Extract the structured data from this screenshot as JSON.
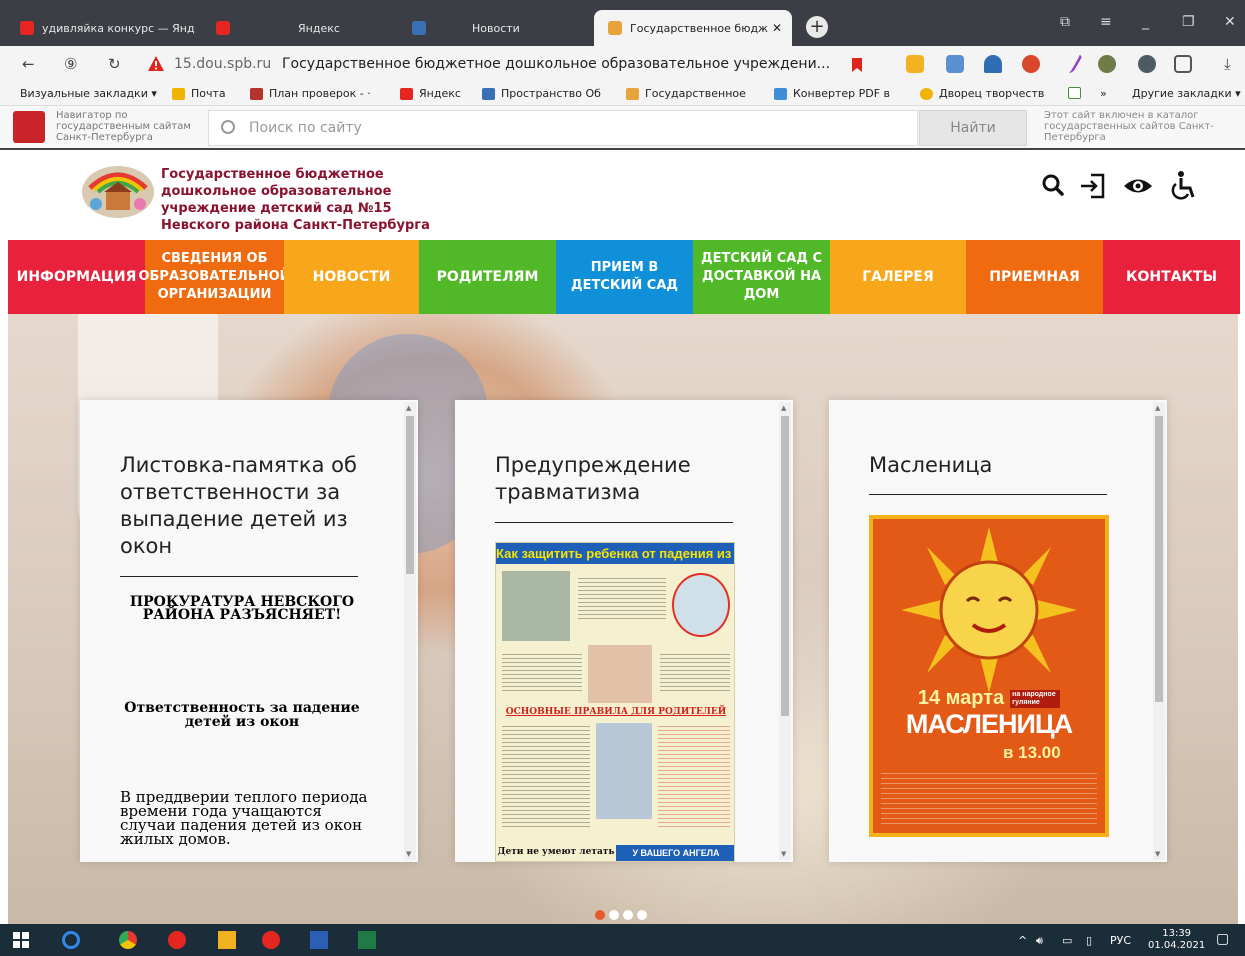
{
  "browser": {
    "tabs": [
      {
        "label": "удивляйка конкурс — Янд",
        "favicon_color": "#e52620"
      },
      {
        "label": "Яндекс",
        "favicon_color": "#e52620"
      },
      {
        "label": "Новости",
        "favicon_color": "#3b6fb6"
      },
      {
        "label": "Государственное бюдж",
        "favicon_color": "#e8a33a"
      }
    ],
    "new_tab_label": "+",
    "address": {
      "host": "15.dou.spb.ru",
      "title": "Государственное бюджетное дошкольное образовательное учреждени..."
    },
    "bookmarks": [
      {
        "label": "Визуальные закладки ▾"
      },
      {
        "label": "Почта"
      },
      {
        "label": "План проверок - ·"
      },
      {
        "label": "Яндекс"
      },
      {
        "label": "Пространство Об"
      },
      {
        "label": "Государственное"
      },
      {
        "label": "Конвертер PDF в"
      },
      {
        "label": "Дворец творчеств"
      },
      {
        "label": "»"
      },
      {
        "label": "Другие закладки ▾"
      }
    ]
  },
  "gov_navigator": {
    "label": "Навигатор по государственным сайтам Санкт-Петербурга",
    "search_placeholder": "Поиск по сайту",
    "find_button": "Найти",
    "catalog_note": "Этот сайт включен в каталог государственных сайтов Санкт-Петербурга"
  },
  "site": {
    "name": "Государственное бюджетное дошкольное образовательное учреждение детский сад №15 Невского района Санкт-Петербурга",
    "menu": [
      {
        "label": "ИНФОРМАЦИЯ",
        "color": "#e8213c"
      },
      {
        "label": "СВЕДЕНИЯ ОБ ОБРАЗОВАТЕЛЬНОЙ ОРГАНИЗАЦИИ",
        "color": "#f06a0f"
      },
      {
        "label": "НОВОСТИ",
        "color": "#f8a71b"
      },
      {
        "label": "РОДИТЕЛЯМ",
        "color": "#51b828"
      },
      {
        "label": "ПРИЕМ В ДЕТСКИЙ САД",
        "color": "#0f90d8"
      },
      {
        "label": "ДЕТСКИЙ САД С ДОСТАВКОЙ НА ДОМ",
        "color": "#51b828"
      },
      {
        "label": "ГАЛЕРЕЯ",
        "color": "#f8a71b"
      },
      {
        "label": "ПРИЕМНАЯ",
        "color": "#f06a0f"
      },
      {
        "label": "КОНТАКТЫ",
        "color": "#e8213c"
      }
    ]
  },
  "cards": [
    {
      "title": "Листовка-памятка об ответственности за выпадение детей из окон",
      "heading": "ПРОКУРАТУРА НЕВСКОГО РАЙОНА РАЗЪЯСНЯЕТ!",
      "subheading": "Ответственность за падение детей из окон",
      "body": "В преддверии теплого периода времени года учащаются случаи падения детей из окон жилых домов."
    },
    {
      "title": "Предупреждение травматизма",
      "poster_title": "Как защитить ребенка от падения из окна?",
      "poster_band": "ОСНОВНЫЕ ПРАВИЛА ДЛЯ РОДИТЕЛЕЙ",
      "poster_footer_left": "Дети не умеют летать",
      "poster_footer_right": "У ВАШЕГО АНГЕЛА"
    },
    {
      "title": "Масленица",
      "poster_date": "14 марта",
      "poster_date_note": "на народное гуляние",
      "poster_event": "МАСЛЕНИЦА",
      "poster_time": "в 13.00"
    }
  ],
  "taskbar": {
    "lang": "РУС",
    "time": "13:39",
    "date": "01.04.2021"
  }
}
